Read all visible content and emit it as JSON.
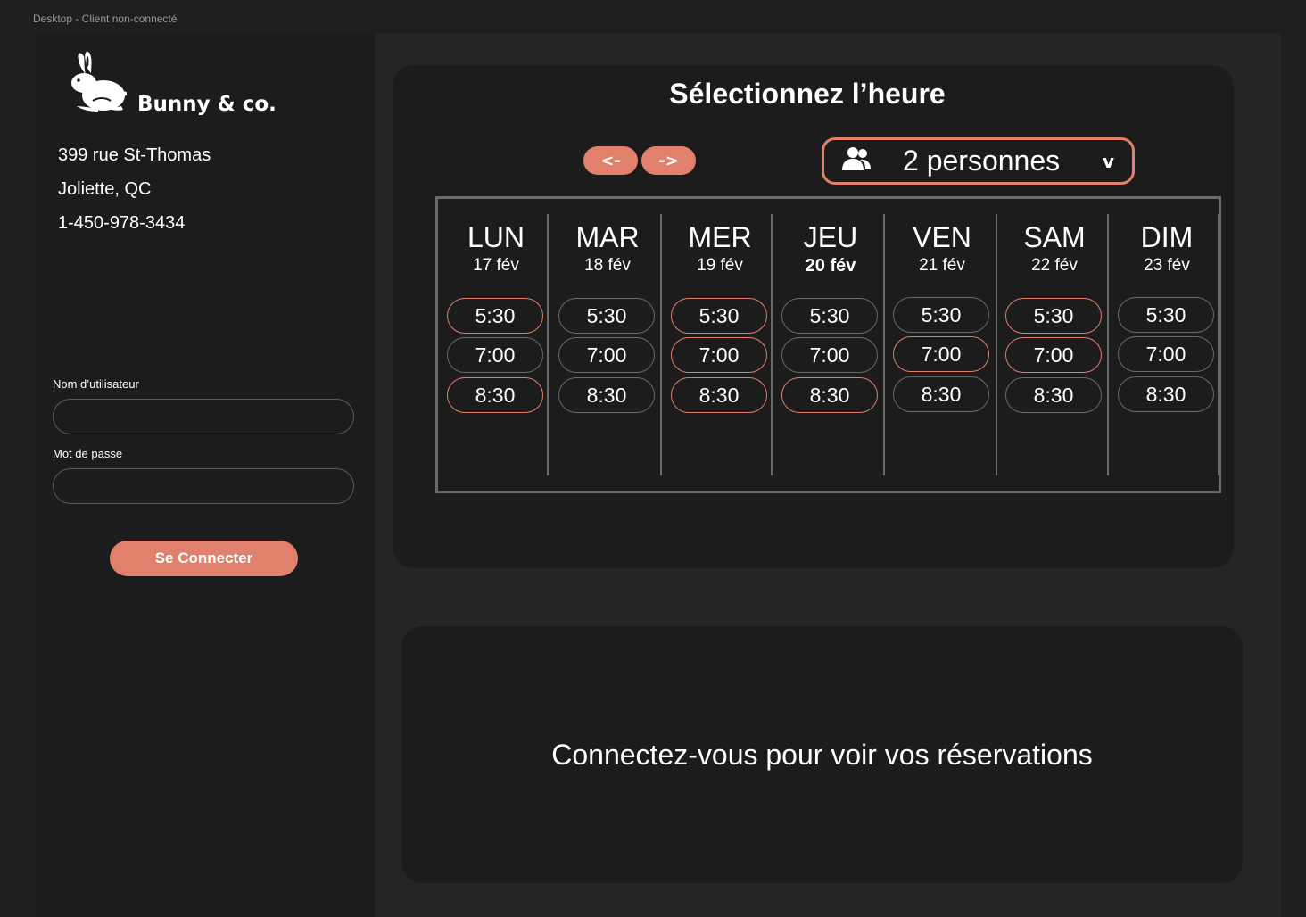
{
  "frame_label": "Desktop -  Client non-connecté",
  "brand": {
    "name": "Bunny & co.",
    "logo_icon": "rabbit-icon"
  },
  "contact": {
    "street": "399 rue St-Thomas",
    "city": "Joliette, QC",
    "phone": "1-450-978-3434"
  },
  "login": {
    "username_label": "Nom d’utilisateur",
    "username_value": "",
    "password_label": "Mot de passe",
    "password_value": "",
    "submit_label": "Se Connecter"
  },
  "schedule": {
    "title": "Sélectionnez l’heure",
    "prev_label": "<-",
    "next_label": "->",
    "party": {
      "icon": "users-icon",
      "label": "2 personnes",
      "chevron": "v"
    },
    "days": [
      {
        "name": "LUN",
        "date": "17 fév",
        "highlight": false,
        "slots": [
          {
            "time": "5:30",
            "available": true
          },
          {
            "time": "7:00",
            "available": false
          },
          {
            "time": "8:30",
            "available": true
          }
        ]
      },
      {
        "name": "MAR",
        "date": "18 fév",
        "highlight": false,
        "slots": [
          {
            "time": "5:30",
            "available": false
          },
          {
            "time": "7:00",
            "available": false
          },
          {
            "time": "8:30",
            "available": false
          }
        ]
      },
      {
        "name": "MER",
        "date": "19 fév",
        "highlight": false,
        "slots": [
          {
            "time": "5:30",
            "available": true
          },
          {
            "time": "7:00",
            "available": true
          },
          {
            "time": "8:30",
            "available": true
          }
        ]
      },
      {
        "name": "JEU",
        "date": "20 fév",
        "highlight": true,
        "slots": [
          {
            "time": "5:30",
            "available": false
          },
          {
            "time": "7:00",
            "available": false
          },
          {
            "time": "8:30",
            "available": true
          }
        ]
      },
      {
        "name": "VEN",
        "date": "21 fév",
        "highlight": false,
        "slots": [
          {
            "time": "5:30",
            "available": false
          },
          {
            "time": "7:00",
            "available": true
          },
          {
            "time": "8:30",
            "available": false
          }
        ]
      },
      {
        "name": "SAM",
        "date": "22 fév",
        "highlight": false,
        "slots": [
          {
            "time": "5:30",
            "available": true
          },
          {
            "time": "7:00",
            "available": true
          },
          {
            "time": "8:30",
            "available": false
          }
        ]
      },
      {
        "name": "DIM",
        "date": "23 fév",
        "highlight": false,
        "slots": [
          {
            "time": "5:30",
            "available": false
          },
          {
            "time": "7:00",
            "available": false
          },
          {
            "time": "8:30",
            "available": false
          }
        ]
      }
    ]
  },
  "reservations": {
    "message": "Connectez-vous pour voir vos réservations"
  },
  "colors": {
    "accent": "#e0806d",
    "background": "#1e1e1e",
    "panel": "#1c1c1c",
    "main": "#232527",
    "border": "#6a6a6a"
  }
}
